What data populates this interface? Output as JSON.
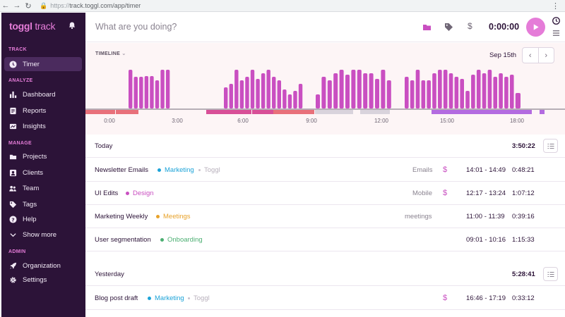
{
  "browser": {
    "url_proto": "https://",
    "url_rest": "track.toggl.com/app/timer"
  },
  "brand": {
    "name": "toggl",
    "suffix": "track"
  },
  "sidebar": {
    "sections": [
      "TRACK",
      "ANALYZE",
      "MANAGE",
      "ADMIN"
    ],
    "items": [
      {
        "label": "Timer",
        "icon": "clock-icon"
      },
      {
        "label": "Dashboard",
        "icon": "bar-chart-icon"
      },
      {
        "label": "Reports",
        "icon": "report-icon"
      },
      {
        "label": "Insights",
        "icon": "insights-icon"
      },
      {
        "label": "Projects",
        "icon": "folder-icon"
      },
      {
        "label": "Clients",
        "icon": "person-icon"
      },
      {
        "label": "Team",
        "icon": "team-icon"
      },
      {
        "label": "Tags",
        "icon": "tag-icon"
      },
      {
        "label": "Help",
        "icon": "help-icon"
      },
      {
        "label": "Show more",
        "icon": "chevron-down-icon"
      },
      {
        "label": "Organization",
        "icon": "rocket-icon"
      },
      {
        "label": "Settings",
        "icon": "gear-icon"
      }
    ]
  },
  "timer": {
    "placeholder": "What are you doing?",
    "elapsed": "0:00:00",
    "dollar": "$"
  },
  "timeline": {
    "label": "TIMELINE",
    "date": "Sep 15th",
    "hours": [
      "0:00",
      "3:00",
      "6:00",
      "9:00",
      "12:00",
      "15:00",
      "18:00"
    ],
    "prev": "‹",
    "next": "›"
  },
  "days": [
    {
      "title": "Today",
      "total": "3:50:22"
    },
    {
      "title": "Yesterday",
      "total": "5:28:41"
    }
  ],
  "entries": [
    {
      "description": "Newsletter Emails",
      "project": "Marketing",
      "project_color": "#1ca3d8",
      "client": "Toggl",
      "tag": "Emails",
      "billable": "$",
      "range": "14:01 - 14:49",
      "duration": "0:48:21"
    },
    {
      "description": "UI Edits",
      "project": "Design",
      "project_color": "#c94fc1",
      "client": "",
      "tag": "Mobile",
      "billable": "$",
      "range": "12:17 - 13:24",
      "duration": "1:07:12"
    },
    {
      "description": "Marketing Weekly",
      "project": "Meetings",
      "project_color": "#e8a22a",
      "client": "",
      "tag": "meetings",
      "billable": "",
      "range": "11:00 - 11:39",
      "duration": "0:39:16"
    },
    {
      "description": "User segmentation",
      "project": "Onboarding",
      "project_color": "#4caf72",
      "client": "",
      "tag": "",
      "billable": "",
      "range": "09:01 - 10:16",
      "duration": "1:15:33"
    },
    {
      "description": "Blog post draft",
      "project": "Marketing",
      "project_color": "#1ca3d8",
      "client": "Toggl",
      "tag": "",
      "billable": "$",
      "range": "16:46 - 17:19",
      "duration": "0:33:12"
    }
  ],
  "colors": {
    "accent": "#e57cd8",
    "sidebar": "#2c1338",
    "bars": "#c94fc1"
  }
}
